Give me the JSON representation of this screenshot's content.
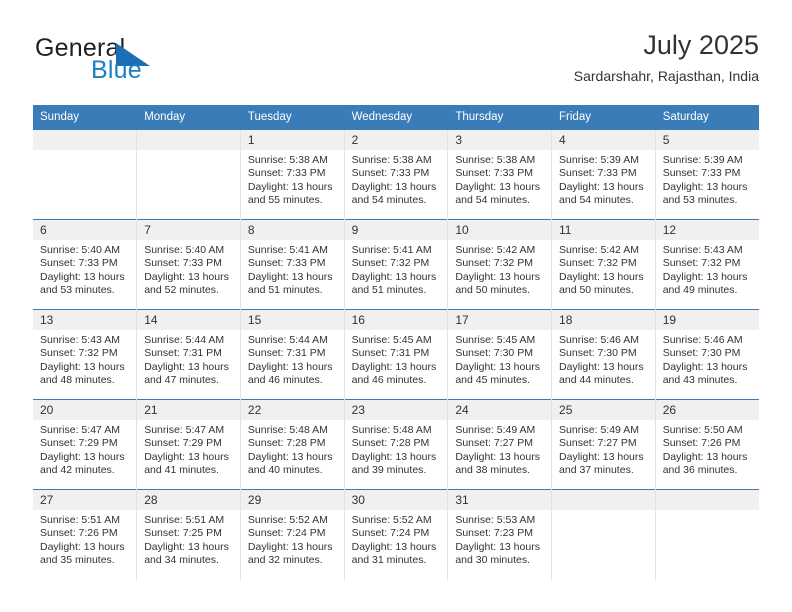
{
  "brand": {
    "name_top": "General",
    "name_bottom": "Blue",
    "flag_icon": "triangle-flag-icon",
    "color_dark": "#231f20",
    "color_blue": "#1c7fc4"
  },
  "header": {
    "title": "July 2025",
    "subtitle": "Sardarshahr, Rajasthan, India"
  },
  "theme": {
    "header_blue": "#3a7cb8",
    "daynum_band": "#f0f0f0",
    "text": "#333333"
  },
  "calendar": {
    "weekday_headers": [
      "Sunday",
      "Monday",
      "Tuesday",
      "Wednesday",
      "Thursday",
      "Friday",
      "Saturday"
    ],
    "labels": {
      "sunrise": "Sunrise:",
      "sunset": "Sunset:",
      "daylight": "Daylight:"
    },
    "weeks": [
      [
        {
          "day": "",
          "sunrise": "",
          "sunset": "",
          "daylight": "",
          "daylight2": ""
        },
        {
          "day": "",
          "sunrise": "",
          "sunset": "",
          "daylight": "",
          "daylight2": ""
        },
        {
          "day": "1",
          "sunrise": "Sunrise: 5:38 AM",
          "sunset": "Sunset: 7:33 PM",
          "daylight": "Daylight: 13 hours",
          "daylight2": "and 55 minutes."
        },
        {
          "day": "2",
          "sunrise": "Sunrise: 5:38 AM",
          "sunset": "Sunset: 7:33 PM",
          "daylight": "Daylight: 13 hours",
          "daylight2": "and 54 minutes."
        },
        {
          "day": "3",
          "sunrise": "Sunrise: 5:38 AM",
          "sunset": "Sunset: 7:33 PM",
          "daylight": "Daylight: 13 hours",
          "daylight2": "and 54 minutes."
        },
        {
          "day": "4",
          "sunrise": "Sunrise: 5:39 AM",
          "sunset": "Sunset: 7:33 PM",
          "daylight": "Daylight: 13 hours",
          "daylight2": "and 54 minutes."
        },
        {
          "day": "5",
          "sunrise": "Sunrise: 5:39 AM",
          "sunset": "Sunset: 7:33 PM",
          "daylight": "Daylight: 13 hours",
          "daylight2": "and 53 minutes."
        }
      ],
      [
        {
          "day": "6",
          "sunrise": "Sunrise: 5:40 AM",
          "sunset": "Sunset: 7:33 PM",
          "daylight": "Daylight: 13 hours",
          "daylight2": "and 53 minutes."
        },
        {
          "day": "7",
          "sunrise": "Sunrise: 5:40 AM",
          "sunset": "Sunset: 7:33 PM",
          "daylight": "Daylight: 13 hours",
          "daylight2": "and 52 minutes."
        },
        {
          "day": "8",
          "sunrise": "Sunrise: 5:41 AM",
          "sunset": "Sunset: 7:33 PM",
          "daylight": "Daylight: 13 hours",
          "daylight2": "and 51 minutes."
        },
        {
          "day": "9",
          "sunrise": "Sunrise: 5:41 AM",
          "sunset": "Sunset: 7:32 PM",
          "daylight": "Daylight: 13 hours",
          "daylight2": "and 51 minutes."
        },
        {
          "day": "10",
          "sunrise": "Sunrise: 5:42 AM",
          "sunset": "Sunset: 7:32 PM",
          "daylight": "Daylight: 13 hours",
          "daylight2": "and 50 minutes."
        },
        {
          "day": "11",
          "sunrise": "Sunrise: 5:42 AM",
          "sunset": "Sunset: 7:32 PM",
          "daylight": "Daylight: 13 hours",
          "daylight2": "and 50 minutes."
        },
        {
          "day": "12",
          "sunrise": "Sunrise: 5:43 AM",
          "sunset": "Sunset: 7:32 PM",
          "daylight": "Daylight: 13 hours",
          "daylight2": "and 49 minutes."
        }
      ],
      [
        {
          "day": "13",
          "sunrise": "Sunrise: 5:43 AM",
          "sunset": "Sunset: 7:32 PM",
          "daylight": "Daylight: 13 hours",
          "daylight2": "and 48 minutes."
        },
        {
          "day": "14",
          "sunrise": "Sunrise: 5:44 AM",
          "sunset": "Sunset: 7:31 PM",
          "daylight": "Daylight: 13 hours",
          "daylight2": "and 47 minutes."
        },
        {
          "day": "15",
          "sunrise": "Sunrise: 5:44 AM",
          "sunset": "Sunset: 7:31 PM",
          "daylight": "Daylight: 13 hours",
          "daylight2": "and 46 minutes."
        },
        {
          "day": "16",
          "sunrise": "Sunrise: 5:45 AM",
          "sunset": "Sunset: 7:31 PM",
          "daylight": "Daylight: 13 hours",
          "daylight2": "and 46 minutes."
        },
        {
          "day": "17",
          "sunrise": "Sunrise: 5:45 AM",
          "sunset": "Sunset: 7:30 PM",
          "daylight": "Daylight: 13 hours",
          "daylight2": "and 45 minutes."
        },
        {
          "day": "18",
          "sunrise": "Sunrise: 5:46 AM",
          "sunset": "Sunset: 7:30 PM",
          "daylight": "Daylight: 13 hours",
          "daylight2": "and 44 minutes."
        },
        {
          "day": "19",
          "sunrise": "Sunrise: 5:46 AM",
          "sunset": "Sunset: 7:30 PM",
          "daylight": "Daylight: 13 hours",
          "daylight2": "and 43 minutes."
        }
      ],
      [
        {
          "day": "20",
          "sunrise": "Sunrise: 5:47 AM",
          "sunset": "Sunset: 7:29 PM",
          "daylight": "Daylight: 13 hours",
          "daylight2": "and 42 minutes."
        },
        {
          "day": "21",
          "sunrise": "Sunrise: 5:47 AM",
          "sunset": "Sunset: 7:29 PM",
          "daylight": "Daylight: 13 hours",
          "daylight2": "and 41 minutes."
        },
        {
          "day": "22",
          "sunrise": "Sunrise: 5:48 AM",
          "sunset": "Sunset: 7:28 PM",
          "daylight": "Daylight: 13 hours",
          "daylight2": "and 40 minutes."
        },
        {
          "day": "23",
          "sunrise": "Sunrise: 5:48 AM",
          "sunset": "Sunset: 7:28 PM",
          "daylight": "Daylight: 13 hours",
          "daylight2": "and 39 minutes."
        },
        {
          "day": "24",
          "sunrise": "Sunrise: 5:49 AM",
          "sunset": "Sunset: 7:27 PM",
          "daylight": "Daylight: 13 hours",
          "daylight2": "and 38 minutes."
        },
        {
          "day": "25",
          "sunrise": "Sunrise: 5:49 AM",
          "sunset": "Sunset: 7:27 PM",
          "daylight": "Daylight: 13 hours",
          "daylight2": "and 37 minutes."
        },
        {
          "day": "26",
          "sunrise": "Sunrise: 5:50 AM",
          "sunset": "Sunset: 7:26 PM",
          "daylight": "Daylight: 13 hours",
          "daylight2": "and 36 minutes."
        }
      ],
      [
        {
          "day": "27",
          "sunrise": "Sunrise: 5:51 AM",
          "sunset": "Sunset: 7:26 PM",
          "daylight": "Daylight: 13 hours",
          "daylight2": "and 35 minutes."
        },
        {
          "day": "28",
          "sunrise": "Sunrise: 5:51 AM",
          "sunset": "Sunset: 7:25 PM",
          "daylight": "Daylight: 13 hours",
          "daylight2": "and 34 minutes."
        },
        {
          "day": "29",
          "sunrise": "Sunrise: 5:52 AM",
          "sunset": "Sunset: 7:24 PM",
          "daylight": "Daylight: 13 hours",
          "daylight2": "and 32 minutes."
        },
        {
          "day": "30",
          "sunrise": "Sunrise: 5:52 AM",
          "sunset": "Sunset: 7:24 PM",
          "daylight": "Daylight: 13 hours",
          "daylight2": "and 31 minutes."
        },
        {
          "day": "31",
          "sunrise": "Sunrise: 5:53 AM",
          "sunset": "Sunset: 7:23 PM",
          "daylight": "Daylight: 13 hours",
          "daylight2": "and 30 minutes."
        },
        {
          "day": "",
          "sunrise": "",
          "sunset": "",
          "daylight": "",
          "daylight2": ""
        },
        {
          "day": "",
          "sunrise": "",
          "sunset": "",
          "daylight": "",
          "daylight2": ""
        }
      ]
    ]
  }
}
